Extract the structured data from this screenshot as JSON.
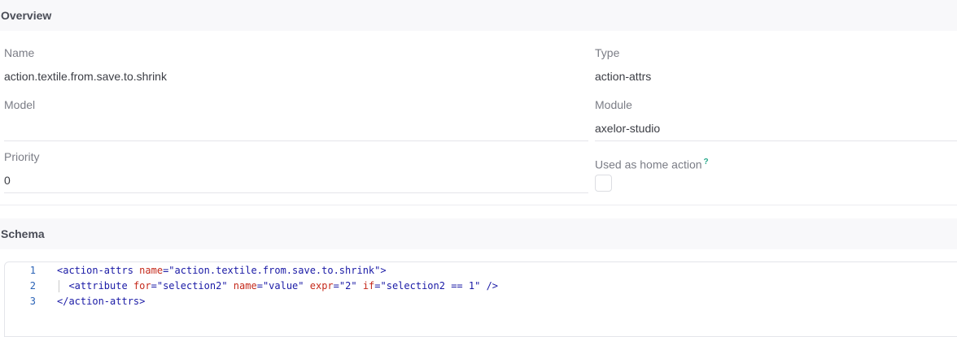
{
  "overview": {
    "title": "Overview",
    "fields": {
      "name": {
        "label": "Name",
        "value": "action.textile.from.save.to.shrink"
      },
      "type": {
        "label": "Type",
        "value": "action-attrs"
      },
      "model": {
        "label": "Model",
        "value": ""
      },
      "module": {
        "label": "Module",
        "value": "axelor-studio"
      },
      "priority": {
        "label": "Priority",
        "value": "0"
      },
      "home_action": {
        "label": "Used as home action",
        "help": "?",
        "checked": false
      }
    }
  },
  "schema": {
    "title": "Schema",
    "lines": [
      {
        "number": "1",
        "tokens": [
          {
            "t": "tag",
            "v": "<action-attrs"
          },
          {
            "t": "text",
            "v": " "
          },
          {
            "t": "attr",
            "v": "name"
          },
          {
            "t": "punct",
            "v": "="
          },
          {
            "t": "str",
            "v": "\"action.textile.from.save.to.shrink\""
          },
          {
            "t": "tag",
            "v": ">"
          }
        ]
      },
      {
        "number": "2",
        "tokens": [
          {
            "t": "text",
            "v": "  "
          },
          {
            "t": "tag",
            "v": "<attribute"
          },
          {
            "t": "text",
            "v": " "
          },
          {
            "t": "attr",
            "v": "for"
          },
          {
            "t": "punct",
            "v": "="
          },
          {
            "t": "str",
            "v": "\"selection2\""
          },
          {
            "t": "text",
            "v": " "
          },
          {
            "t": "attr",
            "v": "name"
          },
          {
            "t": "punct",
            "v": "="
          },
          {
            "t": "str",
            "v": "\"value\""
          },
          {
            "t": "text",
            "v": " "
          },
          {
            "t": "attr",
            "v": "expr"
          },
          {
            "t": "punct",
            "v": "="
          },
          {
            "t": "str",
            "v": "\"2\""
          },
          {
            "t": "text",
            "v": " "
          },
          {
            "t": "attr",
            "v": "if"
          },
          {
            "t": "punct",
            "v": "="
          },
          {
            "t": "str",
            "v": "\"selection2 == 1\""
          },
          {
            "t": "text",
            "v": " "
          },
          {
            "t": "tag",
            "v": "/>"
          }
        ]
      },
      {
        "number": "3",
        "tokens": [
          {
            "t": "tag",
            "v": "</action-attrs>"
          }
        ]
      }
    ]
  },
  "colors": {
    "tag": "#1a1aa6",
    "attribute": "#c52a1b",
    "string": "#1a1aa6",
    "line_number": "#2a62b6",
    "help_mark": "#27a98b"
  }
}
